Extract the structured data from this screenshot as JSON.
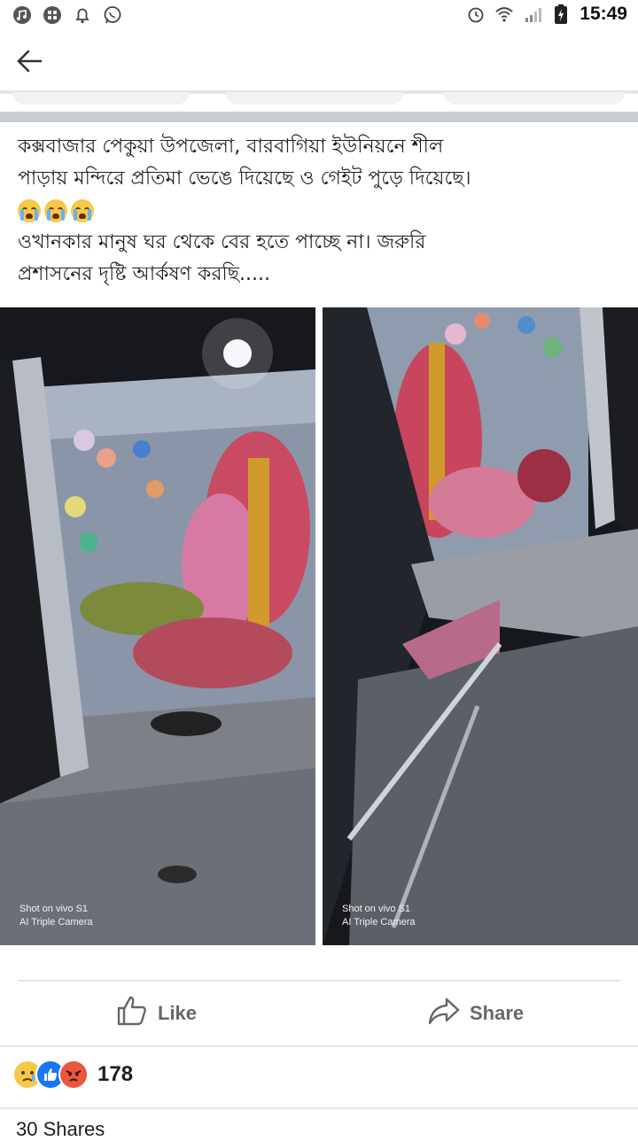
{
  "status_bar": {
    "time": "15:49",
    "left_icons": [
      "music-notification-icon",
      "app-grid-icon",
      "bell-icon",
      "whatsapp-icon"
    ],
    "right_icons": [
      "alarm-icon",
      "wifi-icon",
      "signal-icon",
      "battery-icon"
    ]
  },
  "header": {
    "back_icon": "arrow-left-icon"
  },
  "post": {
    "text_lines": [
      "কক্সবাজার পেকুয়া উপজেলা, বারবাগিয়া ইউনিয়নে শীল",
      "পাড়ায় মন্দিরে প্রতিমা ভেঙে দিয়েছে ও গেইট পুড়ে দিয়েছে।",
      "ওখানকার মানুষ ঘর থেকে বের হতে পাচ্ছে না। জরুরি",
      "প্রশাসনের দৃষ্টি আর্কষণ করছি....."
    ],
    "emoji_row": [
      "crying-face-icon",
      "crying-face-icon",
      "crying-face-icon"
    ],
    "photos": [
      {
        "watermark_line1": "Shot on vivo S1",
        "watermark_line2": "AI Triple Camera"
      },
      {
        "watermark_line1": "Shot on vivo S1",
        "watermark_line2": "AI Triple Camera"
      }
    ]
  },
  "actions": {
    "like_label": "Like",
    "share_label": "Share"
  },
  "reactions": {
    "types": [
      "sad",
      "like",
      "angry"
    ],
    "count": "178"
  },
  "footer": {
    "shares_text": "30 Shares"
  },
  "colors": {
    "like_blue": "#1877f2",
    "action_gray": "#65676b",
    "divider": "#e4e6eb"
  }
}
